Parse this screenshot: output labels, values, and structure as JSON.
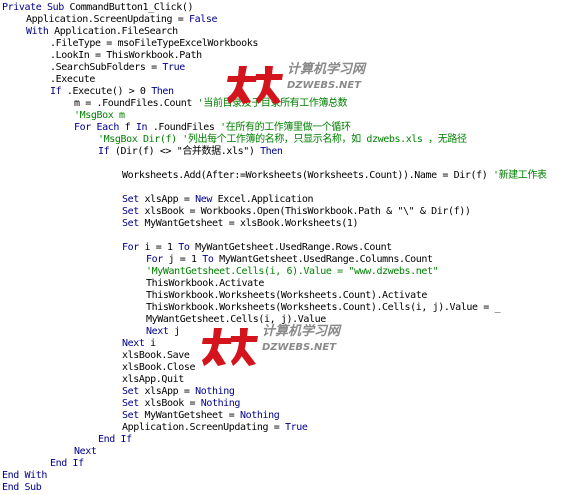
{
  "colors": {
    "keyword": "#00008b",
    "comment": "#008000",
    "text": "#000000",
    "watermark_red": "#d4141c",
    "watermark_gray": "#8a8a8a"
  },
  "watermark": {
    "chinese": "计算机学习网",
    "english": "DZWEBS.NET"
  },
  "code_lines": [
    {
      "indent": 0,
      "parts": [
        {
          "t": "Private Sub",
          "c": "kw"
        },
        {
          "t": " CommandButton1_Click()",
          "c": "tx"
        }
      ]
    },
    {
      "indent": 1,
      "parts": [
        {
          "t": "Application.ScreenUpdating = ",
          "c": "tx"
        },
        {
          "t": "False",
          "c": "kw"
        }
      ]
    },
    {
      "indent": 1,
      "parts": [
        {
          "t": "With",
          "c": "kw"
        },
        {
          "t": " Application.FileSearch",
          "c": "tx"
        }
      ]
    },
    {
      "indent": 2,
      "parts": [
        {
          "t": ".FileType = msoFileTypeExcelWorkbooks",
          "c": "tx"
        }
      ]
    },
    {
      "indent": 2,
      "parts": [
        {
          "t": ".LookIn = ThisWorkbook.Path",
          "c": "tx"
        }
      ]
    },
    {
      "indent": 2,
      "parts": [
        {
          "t": ".SearchSubFolders = ",
          "c": "tx"
        },
        {
          "t": "True",
          "c": "kw"
        }
      ]
    },
    {
      "indent": 2,
      "parts": [
        {
          "t": ".Execute",
          "c": "tx"
        }
      ]
    },
    {
      "indent": 2,
      "parts": [
        {
          "t": "If",
          "c": "kw"
        },
        {
          "t": " .Execute() > 0 ",
          "c": "tx"
        },
        {
          "t": "Then",
          "c": "kw"
        }
      ]
    },
    {
      "indent": 3,
      "parts": [
        {
          "t": "m = .FoundFiles.Count ",
          "c": "tx"
        },
        {
          "t": "'当前目录及子目录所有工作簿总数",
          "c": "cm"
        }
      ]
    },
    {
      "indent": 3,
      "parts": [
        {
          "t": "'MsgBox m",
          "c": "cm"
        }
      ]
    },
    {
      "indent": 3,
      "parts": [
        {
          "t": "For Each",
          "c": "kw"
        },
        {
          "t": " f ",
          "c": "tx"
        },
        {
          "t": "In",
          "c": "kw"
        },
        {
          "t": " .FoundFiles ",
          "c": "tx"
        },
        {
          "t": "'在所有的工作簿里做一个循环",
          "c": "cm"
        }
      ]
    },
    {
      "indent": 4,
      "parts": [
        {
          "t": "'MsgBox Dir(f) '列出每个工作簿的名称，只显示名称，如 dzwebs.xls ，无路径",
          "c": "cm"
        }
      ]
    },
    {
      "indent": 4,
      "parts": [
        {
          "t": "If",
          "c": "kw"
        },
        {
          "t": " (Dir(f) <> \"合并数据.xls\") ",
          "c": "tx"
        },
        {
          "t": "Then",
          "c": "kw"
        }
      ]
    },
    {
      "indent": 0,
      "parts": []
    },
    {
      "indent": 5,
      "parts": [
        {
          "t": "Worksheets.Add(After:=Worksheets(Worksheets.Count)).Name = Dir(f) ",
          "c": "tx"
        },
        {
          "t": "'新建工作表",
          "c": "cm"
        }
      ]
    },
    {
      "indent": 0,
      "parts": []
    },
    {
      "indent": 5,
      "parts": [
        {
          "t": "Set",
          "c": "kw"
        },
        {
          "t": " xlsApp = ",
          "c": "tx"
        },
        {
          "t": "New",
          "c": "kw"
        },
        {
          "t": " Excel.Application",
          "c": "tx"
        }
      ]
    },
    {
      "indent": 5,
      "parts": [
        {
          "t": "Set",
          "c": "kw"
        },
        {
          "t": " xlsBook = Workbooks.Open(ThisWorkbook.Path & \"\\\" & Dir(f))",
          "c": "tx"
        }
      ]
    },
    {
      "indent": 5,
      "parts": [
        {
          "t": "Set",
          "c": "kw"
        },
        {
          "t": " MyWantGetsheet = xlsBook.Worksheets(1)",
          "c": "tx"
        }
      ]
    },
    {
      "indent": 0,
      "parts": []
    },
    {
      "indent": 5,
      "parts": [
        {
          "t": "For",
          "c": "kw"
        },
        {
          "t": " i = 1 ",
          "c": "tx"
        },
        {
          "t": "To",
          "c": "kw"
        },
        {
          "t": " MyWantGetsheet.UsedRange.Rows.Count",
          "c": "tx"
        }
      ]
    },
    {
      "indent": 6,
      "parts": [
        {
          "t": "For",
          "c": "kw"
        },
        {
          "t": " j = 1 ",
          "c": "tx"
        },
        {
          "t": "To",
          "c": "kw"
        },
        {
          "t": " MyWantGetsheet.UsedRange.Columns.Count",
          "c": "tx"
        }
      ]
    },
    {
      "indent": 6,
      "parts": [
        {
          "t": "'MyWantGetsheet.Cells(i, 6).Value = \"www.dzwebs.net\"",
          "c": "cm"
        }
      ]
    },
    {
      "indent": 6,
      "parts": [
        {
          "t": "ThisWorkbook.Activate",
          "c": "tx"
        }
      ]
    },
    {
      "indent": 6,
      "parts": [
        {
          "t": "ThisWorkbook.Worksheets(Worksheets.Count).Activate",
          "c": "tx"
        }
      ]
    },
    {
      "indent": 6,
      "parts": [
        {
          "t": "ThisWorkbook.Worksheets(Worksheets.Count).Cells(i, j).Value = _",
          "c": "tx"
        }
      ]
    },
    {
      "indent": 6,
      "parts": [
        {
          "t": "MyWantGetsheet.Cells(i, j).Value",
          "c": "tx"
        }
      ]
    },
    {
      "indent": 6,
      "parts": [
        {
          "t": "Next",
          "c": "kw"
        },
        {
          "t": " j",
          "c": "tx"
        }
      ]
    },
    {
      "indent": 5,
      "parts": [
        {
          "t": "Next",
          "c": "kw"
        },
        {
          "t": " i",
          "c": "tx"
        }
      ]
    },
    {
      "indent": 5,
      "parts": [
        {
          "t": "xlsBook.Save",
          "c": "tx"
        }
      ]
    },
    {
      "indent": 5,
      "parts": [
        {
          "t": "xlsBook.Close",
          "c": "tx"
        }
      ]
    },
    {
      "indent": 5,
      "parts": [
        {
          "t": "xlsApp.Quit",
          "c": "tx"
        }
      ]
    },
    {
      "indent": 5,
      "parts": [
        {
          "t": "Set",
          "c": "kw"
        },
        {
          "t": " xlsApp = ",
          "c": "tx"
        },
        {
          "t": "Nothing",
          "c": "kw"
        }
      ]
    },
    {
      "indent": 5,
      "parts": [
        {
          "t": "Set",
          "c": "kw"
        },
        {
          "t": " xlsBook = ",
          "c": "tx"
        },
        {
          "t": "Nothing",
          "c": "kw"
        }
      ]
    },
    {
      "indent": 5,
      "parts": [
        {
          "t": "Set",
          "c": "kw"
        },
        {
          "t": " MyWantGetsheet = ",
          "c": "tx"
        },
        {
          "t": "Nothing",
          "c": "kw"
        }
      ]
    },
    {
      "indent": 5,
      "parts": [
        {
          "t": "Application.ScreenUpdating = ",
          "c": "tx"
        },
        {
          "t": "True",
          "c": "kw"
        }
      ]
    },
    {
      "indent": 4,
      "parts": [
        {
          "t": "End If",
          "c": "kw"
        }
      ]
    },
    {
      "indent": 3,
      "parts": [
        {
          "t": "Next",
          "c": "kw"
        }
      ]
    },
    {
      "indent": 2,
      "parts": [
        {
          "t": "End If",
          "c": "kw"
        }
      ]
    },
    {
      "indent": 0,
      "parts": [
        {
          "t": "End With",
          "c": "kw"
        }
      ]
    },
    {
      "indent": 0,
      "parts": [
        {
          "t": "End Sub",
          "c": "kw"
        }
      ]
    }
  ]
}
